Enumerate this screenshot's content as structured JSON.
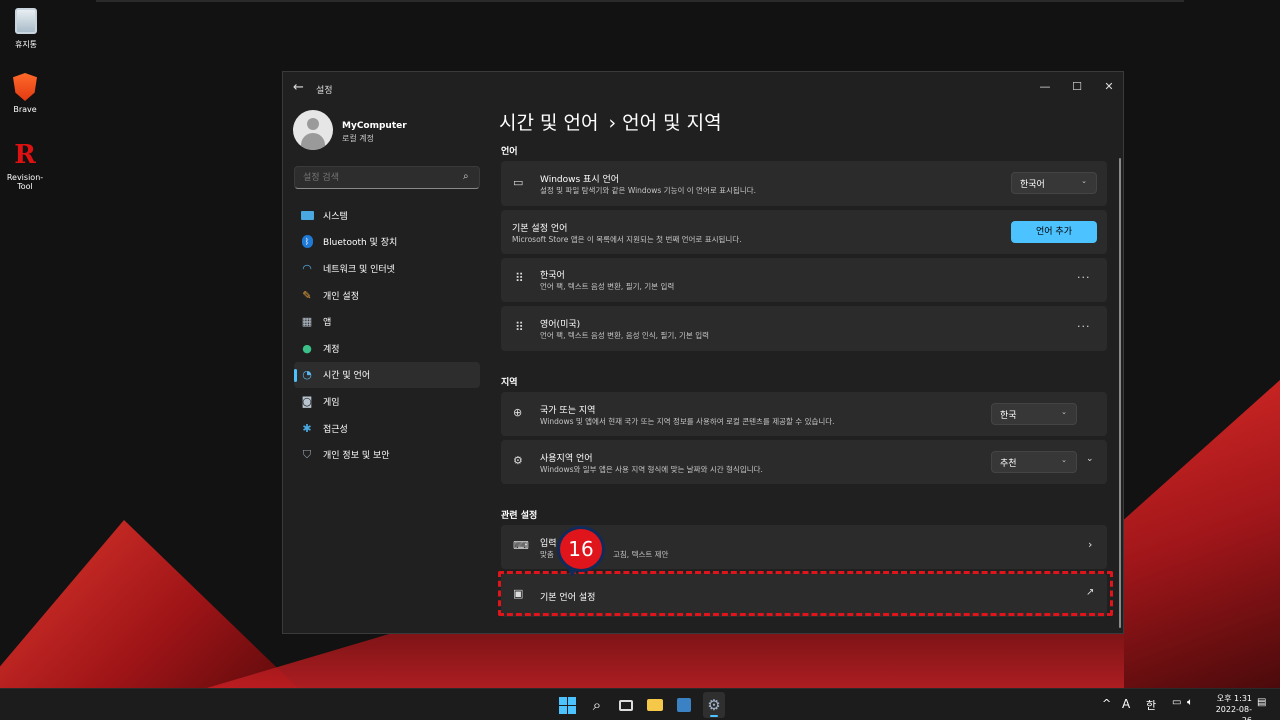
{
  "desktop": {
    "icons": [
      {
        "label": "휴지통",
        "icon": "recycle-bin-icon"
      },
      {
        "label": "Brave",
        "icon": "brave-icon"
      },
      {
        "label": "Revision-Tool",
        "icon": "revision-tool-icon"
      }
    ]
  },
  "window": {
    "title": "설정",
    "controls": {
      "minimize": "—",
      "maximize": "☐",
      "close": "✕"
    }
  },
  "profile": {
    "name": "MyComputer",
    "subtitle": "로컬 계정"
  },
  "search": {
    "placeholder": "설정 검색"
  },
  "sidebar": {
    "items": [
      {
        "label": "시스템",
        "icon": "system-icon"
      },
      {
        "label": "Bluetooth 및 장치",
        "icon": "bluetooth-icon"
      },
      {
        "label": "네트워크 및 인터넷",
        "icon": "wifi-icon"
      },
      {
        "label": "개인 설정",
        "icon": "brush-icon"
      },
      {
        "label": "앱",
        "icon": "apps-icon"
      },
      {
        "label": "계정",
        "icon": "account-icon"
      },
      {
        "label": "시간 및 언어",
        "icon": "globe-clock-icon"
      },
      {
        "label": "게임",
        "icon": "gamepad-icon"
      },
      {
        "label": "접근성",
        "icon": "accessibility-icon"
      },
      {
        "label": "개인 정보 및 보안",
        "icon": "shield-icon"
      }
    ],
    "active_index": 6
  },
  "breadcrumb": {
    "parent": "시간 및 언어",
    "separator": "›",
    "current": "언어 및 지역"
  },
  "sections": {
    "language": {
      "heading": "언어",
      "display_language": {
        "title": "Windows 표시 언어",
        "desc": "설정 및 파일 탐색기와 같은 Windows 기능이 이 언어로 표시됩니다.",
        "value": "한국어"
      },
      "preferred": {
        "title": "기본 설정 언어",
        "desc": "Microsoft Store 앱은 이 목록에서 지원되는 첫 번째 언어로 표시됩니다.",
        "button": "언어 추가"
      },
      "languages": [
        {
          "title": "한국어",
          "desc": "언어 팩, 텍스트 음성 변환, 필기, 기본 입력"
        },
        {
          "title": "영어(미국)",
          "desc": "언어 팩, 텍스트 음성 변환, 음성 인식, 필기, 기본 입력"
        }
      ]
    },
    "region": {
      "heading": "지역",
      "country": {
        "title": "국가 또는 지역",
        "desc": "Windows 및 앱에서 현재 국가 또는 지역 정보를 사용하여 로컬 콘텐츠를 제공할 수 있습니다.",
        "value": "한국"
      },
      "format": {
        "title": "사용지역 언어",
        "desc": "Windows와 일부 앱은 사용 지역 형식에 맞는 날짜와 시간 형식입니다.",
        "value": "추천"
      }
    },
    "related": {
      "heading": "관련 설정",
      "typing": {
        "title": "입력",
        "desc": "맞춤",
        "desc_tail": "고침, 텍스트 제안"
      },
      "admin_language": {
        "title": "기본 언어 설정"
      }
    }
  },
  "annotation": {
    "step": "16",
    "color": "#e0141b"
  },
  "taskbar": {
    "apps": [
      "start-icon",
      "search-icon",
      "task-view-icon",
      "file-explorer-icon",
      "store-icon",
      "settings-icon"
    ],
    "tray": {
      "chevron": "^",
      "ime_a": "A",
      "ime_han": "한"
    },
    "clock": {
      "time": "오후 1:31",
      "date": "2022-08-26"
    }
  },
  "colors": {
    "accent": "#4cc2ff",
    "window_bg": "#202020",
    "card_bg": "#2b2b2b"
  }
}
